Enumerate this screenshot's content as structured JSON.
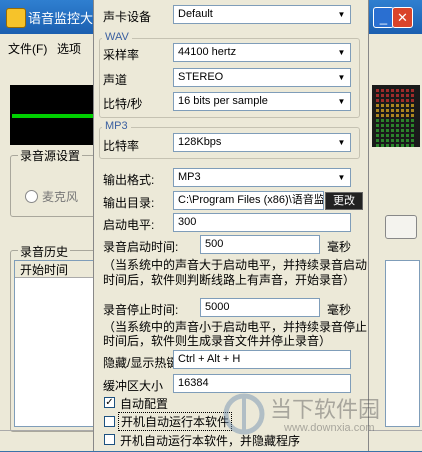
{
  "bg_window": {
    "title": "语音监控大",
    "menu": [
      "文件(F)",
      "选项"
    ],
    "source_group_label": "录音源设置",
    "radio_mic_label": "麦克风",
    "history_group_label": "录音历史",
    "history_column": "开始时间"
  },
  "settings": {
    "soundcard_label": "声卡设备",
    "soundcard_value": "Default",
    "wav_group": "WAV",
    "samplerate_label": "采样率",
    "samplerate_value": "44100 hertz",
    "channel_label": "声道",
    "channel_value": "STEREO",
    "bits_label": "比特/秒",
    "bits_value": "16 bits per sample",
    "mp3_group": "MP3",
    "bitrate_label": "比特率",
    "bitrate_value": "128Kbps",
    "format_label": "输出格式:",
    "format_value": "MP3",
    "outdir_label": "输出目录:",
    "outdir_value": "C:\\Program Files (x86)\\语音监",
    "browse_label": "更改",
    "start_level_label": "启动电平:",
    "start_level_value": "300",
    "start_time_label": "录音启动时间:",
    "start_time_value": "500",
    "start_time_unit": "毫秒",
    "start_note_1": "（当系统中的声音大于启动电平，并持续录音启动",
    "start_note_2": "时间后，软件则判断线路上有声音，开始录音）",
    "stop_time_label": "录音停止时间:",
    "stop_time_value": "5000",
    "stop_time_unit": "毫秒",
    "stop_note_1": "（当系统中的声音小于启动电平，并持续录音停止",
    "stop_note_2": "时间后，软件则生成录音文件并停止录音）",
    "hotkey_label": "隐藏/显示热键",
    "hotkey_value": "Ctrl + Alt + H",
    "buffer_label": "缓冲区大小",
    "buffer_value": "16384",
    "auto_config_label": "自动配置",
    "auto_config_checked": true,
    "autostart_label": "开机自动运行本软件",
    "autostart_checked": false,
    "autostart_hidden_label": "开机自动运行本软件，并隐藏程序",
    "autostart_hidden_checked": false
  },
  "watermark": {
    "cn": "当下软件园",
    "en": "www.downxia.com"
  },
  "colors": {
    "panel_bg": "#ece9d8",
    "titlebar": "#1b5fb0",
    "vu_green": "#00d000"
  }
}
